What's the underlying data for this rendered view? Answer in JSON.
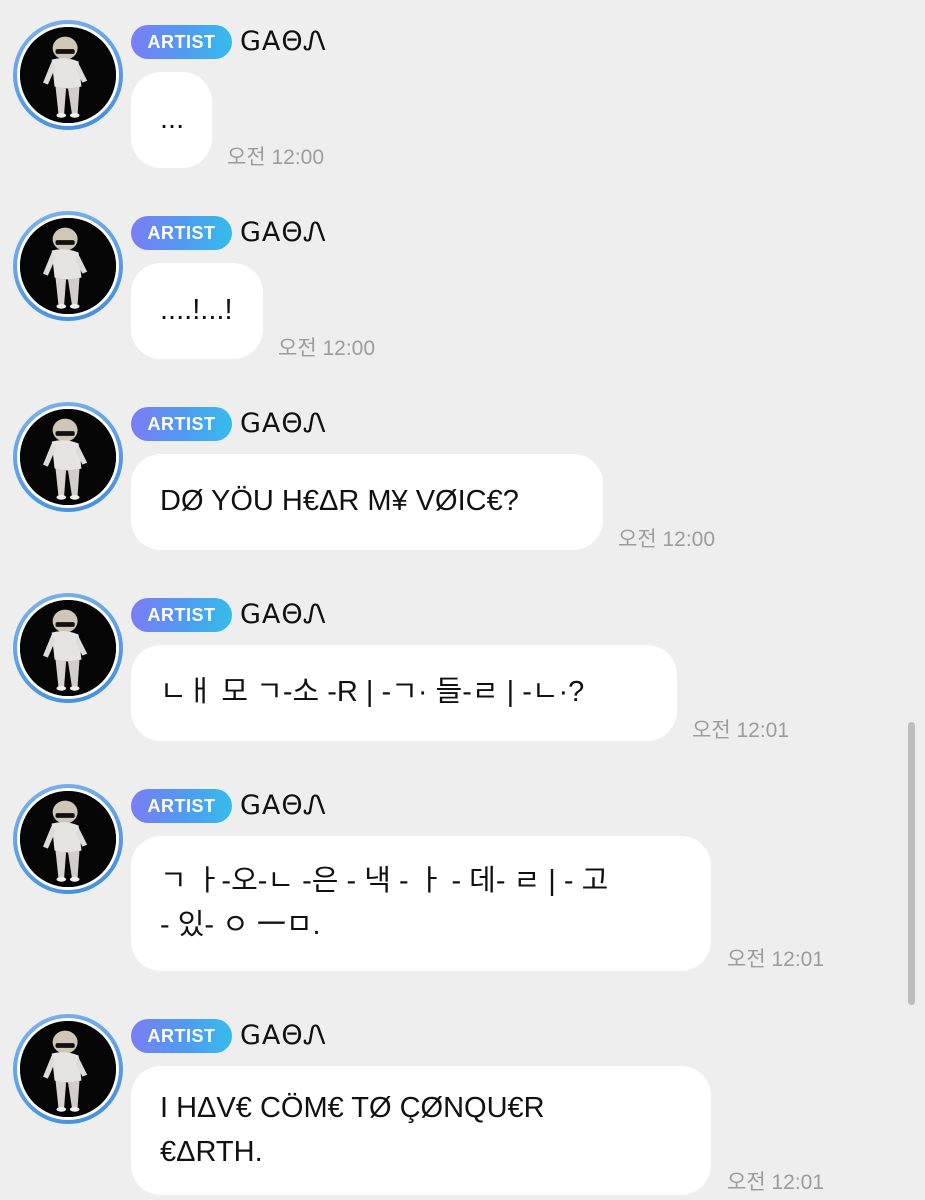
{
  "artist_badge": "ARTIST",
  "sender_name": "GAΘᏁ",
  "messages": [
    {
      "text": "...",
      "time": "오전 12:00"
    },
    {
      "text": "....!...!",
      "time": "오전 12:00"
    },
    {
      "text": "DØ YÖU H€ΔR M¥ VØIC€?",
      "time": "오전 12:00"
    },
    {
      "text": "ㄴㅐ 모 ㄱ-소 -R | -ㄱ· 들-ㄹ | -ㄴ·?",
      "time": "오전 12:01"
    },
    {
      "text": "ㄱ ㅏ-오-ㄴ -은 - 낵 - ㅏ - 데- ㄹ  | - 고\n- 있- ㅇ 一ㅁ.",
      "time": "오전 12:01"
    },
    {
      "text": "I HΔV€ CÖM€ TØ ÇØNQU€R\n€ΔRTH.",
      "time": "오전 12:01"
    }
  ],
  "colors": {
    "background": "#eeeeef",
    "bubble": "#ffffff",
    "badge_gradient": [
      "#7b7df5",
      "#4e9cf0",
      "#35bcea"
    ],
    "avatar_ring": "#3f8ddc",
    "timestamp": "#9c9c9c"
  },
  "icons": {
    "avatar": "artist-profile-photo"
  }
}
